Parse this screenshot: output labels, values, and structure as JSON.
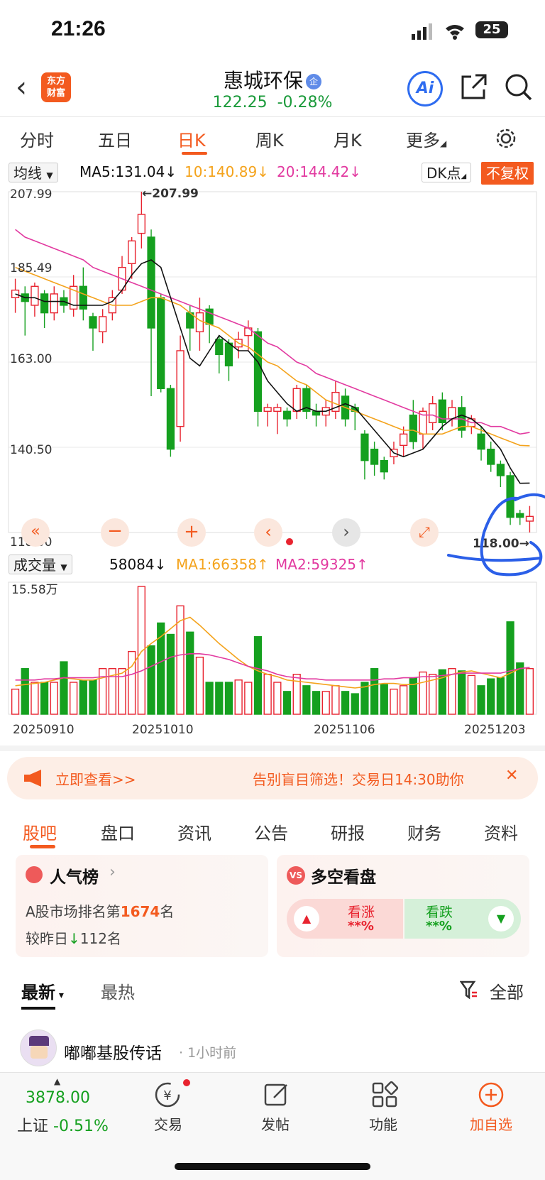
{
  "status": {
    "time": "21:26",
    "battery": "25"
  },
  "header": {
    "logo_top": "东方",
    "logo_bottom": "财富",
    "stock_name": "惠城环保",
    "name_tag": "企",
    "price": "122.25",
    "change_pct": "-0.28%",
    "ai_label": "Ai"
  },
  "ktabs": [
    "分时",
    "五日",
    "日K",
    "周K",
    "月K",
    "更多"
  ],
  "ma_bar": {
    "select": "均线",
    "ma5": "MA5:131.04↓",
    "ma10": "10:140.89↓",
    "ma20": "20:144.42↓",
    "dk": "DK点",
    "fuquan": "不复权"
  },
  "colors": {
    "up": "#e8232f",
    "down": "#15a01f",
    "ma5": "#111111",
    "ma10": "#f4a31c",
    "ma20": "#e23aa0",
    "accent": "#f35a1f"
  },
  "price_axis": [
    "207.99",
    "185.49",
    "163.00",
    "140.50",
    "118.00"
  ],
  "price_marks": {
    "high": "←207.99",
    "low": "118.00→"
  },
  "vol_bar": {
    "select": "成交量",
    "vol": "58084↓",
    "ma1": "MA1:66358↑",
    "ma2": "MA2:59325↑",
    "axis_top": "15.58万"
  },
  "dates": [
    "20250910",
    "20251010",
    "20251106",
    "20251203"
  ],
  "chart_data": {
    "type": "candlestick",
    "ylim": [
      118.0,
      207.99
    ],
    "candles": [
      {
        "o": 180,
        "c": 182,
        "h": 185,
        "l": 176
      },
      {
        "o": 181,
        "c": 179,
        "h": 183,
        "l": 170
      },
      {
        "o": 178,
        "c": 183,
        "h": 184,
        "l": 175
      },
      {
        "o": 181,
        "c": 176,
        "h": 182,
        "l": 172
      },
      {
        "o": 176,
        "c": 181,
        "h": 183,
        "l": 174
      },
      {
        "o": 180,
        "c": 178,
        "h": 182,
        "l": 176
      },
      {
        "o": 177,
        "c": 183,
        "h": 186,
        "l": 175
      },
      {
        "o": 183,
        "c": 177,
        "h": 188,
        "l": 174
      },
      {
        "o": 175,
        "c": 172,
        "h": 176,
        "l": 166
      },
      {
        "o": 171,
        "c": 175,
        "h": 177,
        "l": 168
      },
      {
        "o": 176,
        "c": 180,
        "h": 182,
        "l": 174
      },
      {
        "o": 182,
        "c": 188,
        "h": 191,
        "l": 181
      },
      {
        "o": 189,
        "c": 195,
        "h": 196,
        "l": 185
      },
      {
        "o": 197,
        "c": 202,
        "h": 207.99,
        "l": 193
      },
      {
        "o": 196,
        "c": 172,
        "h": 198,
        "l": 154
      },
      {
        "o": 180,
        "c": 156,
        "h": 181,
        "l": 155
      },
      {
        "o": 156,
        "c": 140,
        "h": 157,
        "l": 138
      },
      {
        "o": 146,
        "c": 166,
        "h": 170,
        "l": 142
      },
      {
        "o": 176,
        "c": 172,
        "h": 178,
        "l": 166
      },
      {
        "o": 171,
        "c": 176,
        "h": 180,
        "l": 166
      },
      {
        "o": 177,
        "c": 173,
        "h": 178,
        "l": 168
      },
      {
        "o": 169,
        "c": 165,
        "h": 170,
        "l": 160
      },
      {
        "o": 168,
        "c": 162,
        "h": 169,
        "l": 158
      },
      {
        "o": 167,
        "c": 169,
        "h": 171,
        "l": 164
      },
      {
        "o": 170,
        "c": 172,
        "h": 174,
        "l": 166
      },
      {
        "o": 171,
        "c": 150,
        "h": 172,
        "l": 146
      },
      {
        "o": 150,
        "c": 151,
        "h": 152,
        "l": 146
      },
      {
        "o": 150,
        "c": 151,
        "h": 152,
        "l": 144
      },
      {
        "o": 150,
        "c": 148,
        "h": 151,
        "l": 146
      },
      {
        "o": 150,
        "c": 156,
        "h": 157,
        "l": 148
      },
      {
        "o": 156,
        "c": 150,
        "h": 157,
        "l": 148
      },
      {
        "o": 150,
        "c": 149,
        "h": 152,
        "l": 146
      },
      {
        "o": 149,
        "c": 151,
        "h": 153,
        "l": 146
      },
      {
        "o": 150,
        "c": 155,
        "h": 158,
        "l": 148
      },
      {
        "o": 154,
        "c": 148,
        "h": 156,
        "l": 146
      },
      {
        "o": 151,
        "c": 150,
        "h": 152,
        "l": 145
      },
      {
        "o": 144,
        "c": 137,
        "h": 145,
        "l": 132
      },
      {
        "o": 140,
        "c": 136,
        "h": 142,
        "l": 133
      },
      {
        "o": 137,
        "c": 134,
        "h": 138,
        "l": 132
      },
      {
        "o": 138,
        "c": 140,
        "h": 142,
        "l": 136
      },
      {
        "o": 141,
        "c": 144,
        "h": 146,
        "l": 138
      },
      {
        "o": 149,
        "c": 142,
        "h": 153,
        "l": 140
      },
      {
        "o": 144,
        "c": 150,
        "h": 151,
        "l": 140
      },
      {
        "o": 147,
        "c": 152,
        "h": 154,
        "l": 145
      },
      {
        "o": 153,
        "c": 147,
        "h": 155,
        "l": 145
      },
      {
        "o": 148,
        "c": 151,
        "h": 153,
        "l": 146
      },
      {
        "o": 151,
        "c": 145,
        "h": 154,
        "l": 143
      },
      {
        "o": 146,
        "c": 148,
        "h": 149,
        "l": 144
      },
      {
        "o": 144,
        "c": 140,
        "h": 146,
        "l": 137
      },
      {
        "o": 140,
        "c": 136,
        "h": 142,
        "l": 134
      },
      {
        "o": 136,
        "c": 133,
        "h": 137,
        "l": 130
      },
      {
        "o": 133,
        "c": 122,
        "h": 134,
        "l": 120
      },
      {
        "o": 123,
        "c": 122,
        "h": 124,
        "l": 120
      },
      {
        "o": 121,
        "c": 122.25,
        "h": 125,
        "l": 118
      }
    ],
    "ma5": [
      181,
      180,
      180,
      179,
      179,
      179,
      178,
      178,
      178,
      178,
      179,
      182,
      186,
      189,
      190,
      188,
      180,
      172,
      164,
      162,
      166,
      170,
      168,
      166,
      166,
      163,
      158,
      155,
      152,
      150,
      151,
      150,
      150,
      151,
      152,
      151,
      148,
      145,
      142,
      139,
      138,
      139,
      140,
      143,
      146,
      148,
      149,
      148,
      146,
      143,
      140,
      135,
      131,
      131.04
    ],
    "ma10": [
      188,
      187,
      186,
      185,
      184,
      183,
      182,
      181,
      180,
      179,
      178,
      178,
      178,
      179,
      180,
      180,
      179,
      178,
      176,
      174,
      173,
      172,
      170,
      168,
      167,
      165,
      163,
      162,
      160,
      158,
      157,
      155,
      153,
      152,
      151,
      150,
      149,
      148,
      147,
      146,
      145,
      145,
      144,
      144,
      144,
      145,
      146,
      146,
      145,
      144,
      143,
      142,
      141,
      140.89
    ],
    "ma20": [
      198,
      196,
      195,
      194,
      193,
      192,
      191,
      190,
      188,
      187,
      186,
      185,
      184,
      183,
      182,
      181,
      180,
      179,
      178,
      177,
      176,
      175,
      174,
      173,
      172,
      170,
      168,
      167,
      165,
      163,
      162,
      160,
      159,
      158,
      157,
      156,
      155,
      154,
      153,
      152,
      151,
      150,
      149,
      149,
      148,
      148,
      148,
      147,
      147,
      146,
      146,
      145,
      144,
      144.42
    ],
    "volumes": [
      22,
      40,
      28,
      28,
      28,
      46,
      28,
      30,
      30,
      40,
      40,
      40,
      55,
      112,
      60,
      80,
      70,
      95,
      72,
      50,
      28,
      28,
      28,
      30,
      28,
      68,
      35,
      28,
      20,
      35,
      25,
      20,
      20,
      25,
      20,
      18,
      28,
      40,
      26,
      22,
      25,
      32,
      37,
      35,
      39,
      40,
      38,
      34,
      25,
      31,
      32,
      81,
      45,
      40
    ],
    "vol_ma1": [
      25,
      26,
      27,
      28,
      30,
      32,
      31,
      30,
      30,
      32,
      34,
      36,
      42,
      55,
      62,
      68,
      75,
      82,
      85,
      78,
      70,
      62,
      55,
      48,
      42,
      38,
      35,
      33,
      30,
      29,
      28,
      27,
      26,
      25,
      24,
      23,
      24,
      26,
      27,
      27,
      26,
      26,
      28,
      30,
      32,
      35,
      37,
      38,
      36,
      34,
      32,
      36,
      40,
      41
    ],
    "vol_ma2": [
      30,
      30,
      30,
      31,
      31,
      32,
      32,
      32,
      32,
      33,
      33,
      33,
      35,
      38,
      42,
      46,
      50,
      52,
      53,
      53,
      52,
      50,
      48,
      45,
      42,
      40,
      38,
      35,
      33,
      32,
      31,
      31,
      30,
      30,
      30,
      30,
      30,
      30,
      31,
      31,
      32,
      32,
      33,
      33,
      34,
      35,
      36,
      36,
      36,
      36,
      36,
      38,
      40,
      41
    ],
    "vol_max": 15.58
  },
  "banner": {
    "label": "立即查看>>",
    "text": "告别盲目筛选！交易日14:30助你"
  },
  "subtabs": [
    "股吧",
    "盘口",
    "资讯",
    "公告",
    "研报",
    "财务",
    "资料"
  ],
  "popularity": {
    "title": "人气榜",
    "rank_prefix": "A股市场排名第",
    "rank": "1674",
    "rank_suffix": "名",
    "change_prefix": "较昨日",
    "change": "112",
    "change_suffix": "名"
  },
  "bull_bear": {
    "title": "多空看盘",
    "up_label": "看涨",
    "up_value": "**%",
    "down_label": "看跌",
    "down_value": "**%"
  },
  "feed": {
    "sort_new": "最新",
    "sort_hot": "最热",
    "filter": "全部",
    "author": "嘟嘟基股传话",
    "time": "1小时前"
  },
  "index": {
    "value": "3878.00",
    "name": "上证",
    "change": "-0.51%"
  },
  "nav": [
    "交易",
    "发帖",
    "功能",
    "加自选"
  ]
}
